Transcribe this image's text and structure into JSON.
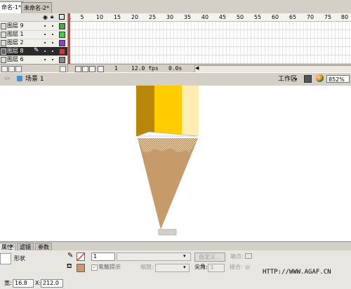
{
  "document_tabs": [
    {
      "label": "命名-1*",
      "active": true
    },
    {
      "label": "未命名-2*",
      "active": false
    }
  ],
  "timeline": {
    "layers": [
      {
        "name": "图层 9",
        "color": "#44aa44",
        "selected": false
      },
      {
        "name": "图层 1",
        "color": "#44cc44",
        "selected": false
      },
      {
        "name": "图层 2",
        "color": "#8844cc",
        "selected": false
      },
      {
        "name": "图层 8",
        "color": "#dd3333",
        "selected": true
      },
      {
        "name": "图层 6",
        "color": "#888888",
        "selected": false
      }
    ],
    "ruler_ticks": [
      "1",
      "5",
      "10",
      "15",
      "20",
      "25",
      "30",
      "35",
      "40",
      "45",
      "50",
      "55",
      "60",
      "65",
      "70",
      "75",
      "80"
    ],
    "current_frame": "1",
    "frame_rate": "12.0 fps",
    "elapsed_time": "0.0s"
  },
  "edit_bar": {
    "scene_label": "场景 1",
    "workspace_label": "工作区",
    "zoom_value": "852%"
  },
  "properties": {
    "tabs": [
      {
        "label": "属性",
        "active": true
      },
      {
        "label": "滤镜",
        "active": false
      },
      {
        "label": "参数",
        "active": false
      }
    ],
    "shape_label": "形状",
    "stroke_value": "1",
    "custom_button": "自定义...",
    "cap_label": "端点:",
    "stroke_hint_label": "笔触提示",
    "scale_label": "缩放:",
    "miter_label": "尖角:",
    "miter_value": "3",
    "join_label": "接合:",
    "width_label": "宽:",
    "width_value": "16.8",
    "x_label": "X:",
    "x_value": "212.0",
    "watermark": "HTTP://WWW.AGAF.CN"
  },
  "colors": {
    "pencil_dark": "#b8860b",
    "pencil_mid": "#ffcc00",
    "pencil_light": "#ffecb0",
    "wood": "#c79a6a",
    "fill_swatch": "#c79a6a"
  }
}
